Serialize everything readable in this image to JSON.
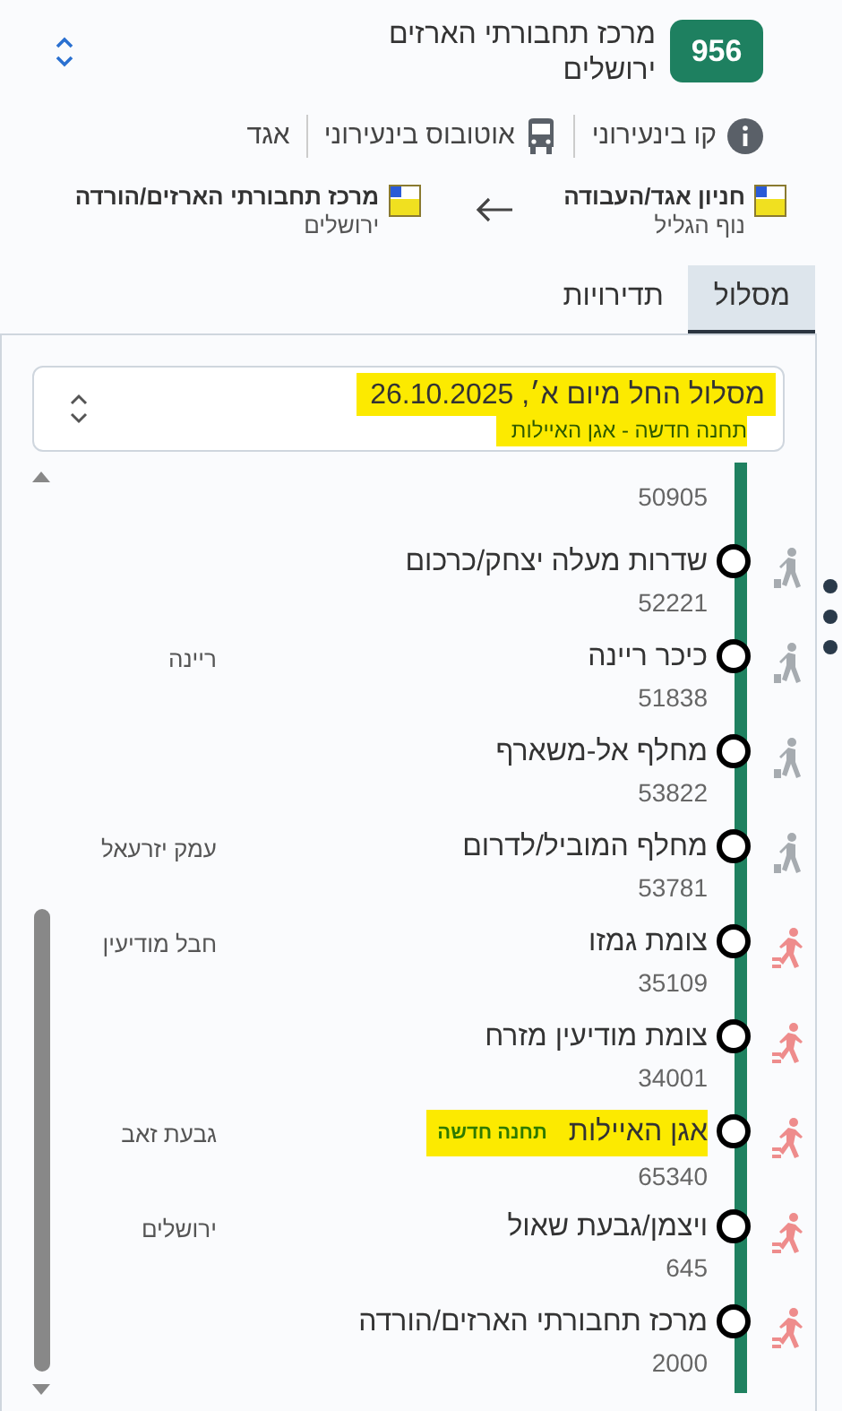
{
  "route": {
    "number": "956",
    "title": "מרכז תחבורתי הארזים",
    "city": "ירושלים"
  },
  "info": [
    {
      "kind": "info",
      "text": "קו בינעירוני"
    },
    {
      "kind": "bus",
      "text": "אוטובוס בינעירוני"
    },
    {
      "kind": "operator",
      "text": "אגד"
    }
  ],
  "endpoints": {
    "origin": {
      "name": "חניון אגד/העבודה",
      "city": "נוף הגליל"
    },
    "destination": {
      "name": "מרכז תחבורתי הארזים/הורדה",
      "city": "ירושלים"
    }
  },
  "tabs": [
    {
      "label": "מסלול",
      "selected": true
    },
    {
      "label": "תדירויות",
      "selected": false
    }
  ],
  "schedule_select": {
    "title": "מסלול החל מיום א׳, 26.10.2025",
    "note": "תחנה חדשה - אגן האיילות"
  },
  "stops": [
    {
      "code": "50905"
    },
    {
      "name": "שדרות מעלה יצחק/כרכום",
      "code": "52221",
      "kind": "walking"
    },
    {
      "name": "כיכר ריינה",
      "code": "51838",
      "city": "ריינה",
      "kind": "walking"
    },
    {
      "name": "מחלף אל-משארף",
      "code": "53822",
      "kind": "walking"
    },
    {
      "name": "מחלף המוביל/לדרום",
      "code": "53781",
      "city": "עמק יזרעאל",
      "kind": "walking"
    },
    {
      "name": "צומת גמזו",
      "code": "35109",
      "city": "חבל מודיעין",
      "kind": "running"
    },
    {
      "name": "צומת מודיעין מזרח",
      "code": "34001",
      "kind": "running"
    },
    {
      "name": "אגן האיילות",
      "code": "65340",
      "city": "גבעת זאב",
      "kind": "running",
      "highlighted": true,
      "badge": "תחנה חדשה"
    },
    {
      "name": "ויצמן/גבעת שאול",
      "code": "645",
      "city": "ירושלים",
      "kind": "running"
    },
    {
      "name": "מרכז תחבורתי הארזים/הורדה",
      "code": "2000",
      "kind": "running"
    }
  ]
}
